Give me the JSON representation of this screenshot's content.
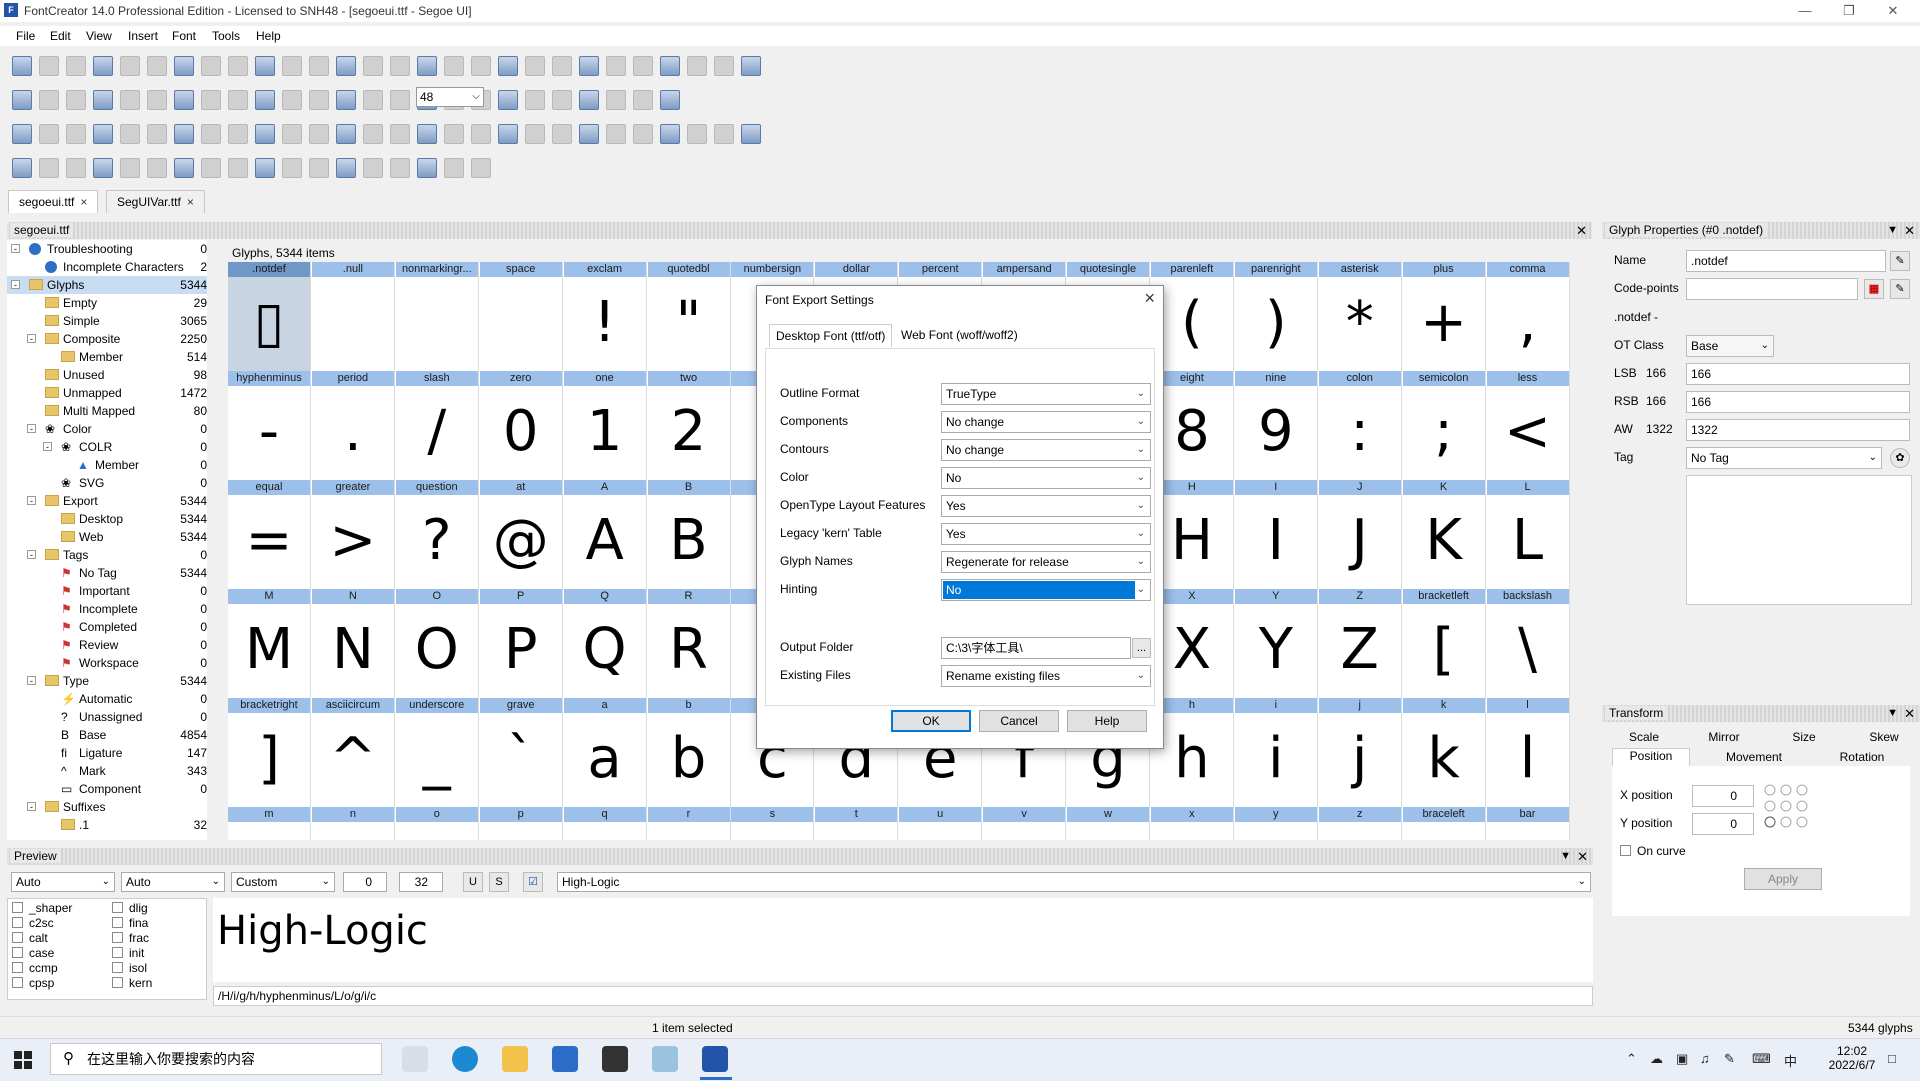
{
  "window": {
    "title": "FontCreator 14.0 Professional Edition - Licensed to SNH48 - [segoeui.ttf - Segoe UI]"
  },
  "menu": [
    "File",
    "Edit",
    "View",
    "Insert",
    "Font",
    "Tools",
    "Help"
  ],
  "toolbar": {
    "zoom_value": "48"
  },
  "file_tabs": [
    {
      "label": "segoeui.ttf",
      "close": "×"
    },
    {
      "label": "SegUIVar.ttf",
      "close": "×"
    }
  ],
  "overview": {
    "panel_title": "segoeui.ttf",
    "grid_caption": "Glyphs, 5344 items",
    "tree": [
      {
        "label": "Troubleshooting",
        "count": "0",
        "icon": "info-icon"
      },
      {
        "label": "Incomplete Characters",
        "count": "2",
        "icon": "info-icon"
      },
      {
        "label": "Glyphs",
        "count": "5344",
        "icon": "folder-icon"
      },
      {
        "label": "Empty",
        "count": "29",
        "icon": "folder-icon"
      },
      {
        "label": "Simple",
        "count": "3065",
        "icon": "folder-icon"
      },
      {
        "label": "Composite",
        "count": "2250",
        "icon": "folder-icon"
      },
      {
        "label": "Member",
        "count": "514",
        "icon": "folder-icon"
      },
      {
        "label": "Unused",
        "count": "98",
        "icon": "folder-icon"
      },
      {
        "label": "Unmapped",
        "count": "1472",
        "icon": "folder-icon"
      },
      {
        "label": "Multi Mapped",
        "count": "80",
        "icon": "folder-icon"
      },
      {
        "label": "Color",
        "count": "0",
        "icon": "palette-icon"
      },
      {
        "label": "COLR",
        "count": "0",
        "icon": "palette-icon"
      },
      {
        "label": "Member",
        "count": "0",
        "icon": "triangle-icon"
      },
      {
        "label": "SVG",
        "count": "0",
        "icon": "palette-icon"
      },
      {
        "label": "Export",
        "count": "5344",
        "icon": "folder-icon"
      },
      {
        "label": "Desktop",
        "count": "5344",
        "icon": "folder-icon"
      },
      {
        "label": "Web",
        "count": "5344",
        "icon": "folder-icon"
      },
      {
        "label": "Tags",
        "count": "0",
        "icon": "folder-icon"
      },
      {
        "label": "No Tag",
        "count": "5344",
        "icon": "flag-icon"
      },
      {
        "label": "Important",
        "count": "0",
        "icon": "flag-icon"
      },
      {
        "label": "Incomplete",
        "count": "0",
        "icon": "flag-icon"
      },
      {
        "label": "Completed",
        "count": "0",
        "icon": "flag-icon"
      },
      {
        "label": "Review",
        "count": "0",
        "icon": "flag-icon"
      },
      {
        "label": "Workspace",
        "count": "0",
        "icon": "flag-icon"
      },
      {
        "label": "Type",
        "count": "5344",
        "icon": "folder-icon"
      },
      {
        "label": "Automatic",
        "count": "0",
        "icon": "bolt-icon"
      },
      {
        "label": "Unassigned",
        "count": "0",
        "icon": "question-icon"
      },
      {
        "label": "Base",
        "count": "4854",
        "icon": "letter-b-icon"
      },
      {
        "label": "Ligature",
        "count": "147",
        "icon": "ligature-icon"
      },
      {
        "label": "Mark",
        "count": "343",
        "icon": "caret-icon"
      },
      {
        "label": "Component",
        "count": "0",
        "icon": "component-icon"
      },
      {
        "label": "Suffixes",
        "count": "",
        "icon": "folder-icon"
      },
      {
        "label": ".1",
        "count": "32",
        "icon": "folder-icon"
      }
    ],
    "glyph_rows": [
      [
        [
          ".notdef",
          "▯"
        ],
        [
          ".null",
          ""
        ],
        [
          "nonmarkingr...",
          ""
        ],
        [
          "space",
          ""
        ],
        [
          "exclam",
          "!"
        ],
        [
          "quotedbl",
          "\""
        ],
        [
          "numbersign",
          ""
        ],
        [
          "dollar",
          ""
        ],
        [
          "percent",
          ""
        ],
        [
          "ampersand",
          ""
        ],
        [
          "quotesingle",
          ""
        ],
        [
          "parenleft",
          "("
        ],
        [
          "parenright",
          ")"
        ],
        [
          "asterisk",
          "*"
        ],
        [
          "plus",
          "+"
        ],
        [
          "comma",
          ","
        ]
      ],
      [
        [
          "hyphenminus",
          "-"
        ],
        [
          "period",
          "."
        ],
        [
          "slash",
          "/"
        ],
        [
          "zero",
          "0"
        ],
        [
          "one",
          "1"
        ],
        [
          "two",
          "2"
        ],
        [
          "",
          ""
        ],
        [
          "",
          ""
        ],
        [
          "",
          ""
        ],
        [
          "",
          ""
        ],
        [
          "",
          ""
        ],
        [
          "eight",
          "8"
        ],
        [
          "nine",
          "9"
        ],
        [
          "colon",
          ":"
        ],
        [
          "semicolon",
          ";"
        ],
        [
          "less",
          "<"
        ]
      ],
      [
        [
          "equal",
          "="
        ],
        [
          "greater",
          ">"
        ],
        [
          "question",
          "?"
        ],
        [
          "at",
          "@"
        ],
        [
          "A",
          "A"
        ],
        [
          "B",
          "B"
        ],
        [
          "",
          ""
        ],
        [
          "",
          ""
        ],
        [
          "",
          ""
        ],
        [
          "",
          ""
        ],
        [
          "",
          ""
        ],
        [
          "H",
          "H"
        ],
        [
          "I",
          "I"
        ],
        [
          "J",
          "J"
        ],
        [
          "K",
          "K"
        ],
        [
          "L",
          "L"
        ]
      ],
      [
        [
          "M",
          "M"
        ],
        [
          "N",
          "N"
        ],
        [
          "O",
          "O"
        ],
        [
          "P",
          "P"
        ],
        [
          "Q",
          "Q"
        ],
        [
          "R",
          "R"
        ],
        [
          "",
          ""
        ],
        [
          "",
          ""
        ],
        [
          "",
          ""
        ],
        [
          "",
          ""
        ],
        [
          "",
          ""
        ],
        [
          "X",
          "X"
        ],
        [
          "Y",
          "Y"
        ],
        [
          "Z",
          "Z"
        ],
        [
          "bracketleft",
          "["
        ],
        [
          "backslash",
          "\\"
        ]
      ],
      [
        [
          "bracketright",
          "]"
        ],
        [
          "asciicircum",
          "^"
        ],
        [
          "underscore",
          "_"
        ],
        [
          "grave",
          "`"
        ],
        [
          "a",
          "a"
        ],
        [
          "b",
          "b"
        ],
        [
          "",
          "c"
        ],
        [
          "",
          "d"
        ],
        [
          "",
          "e"
        ],
        [
          "",
          "f"
        ],
        [
          "",
          "g"
        ],
        [
          "h",
          "h"
        ],
        [
          "i",
          "i"
        ],
        [
          "j",
          "j"
        ],
        [
          "k",
          "k"
        ],
        [
          "l",
          "l"
        ]
      ],
      [
        [
          "m",
          ""
        ],
        [
          "n",
          ""
        ],
        [
          "o",
          ""
        ],
        [
          "p",
          ""
        ],
        [
          "q",
          ""
        ],
        [
          "r",
          ""
        ],
        [
          "s",
          ""
        ],
        [
          "t",
          ""
        ],
        [
          "u",
          ""
        ],
        [
          "v",
          ""
        ],
        [
          "w",
          ""
        ],
        [
          "x",
          ""
        ],
        [
          "y",
          ""
        ],
        [
          "z",
          ""
        ],
        [
          "braceleft",
          ""
        ],
        [
          "bar",
          ""
        ]
      ]
    ]
  },
  "dialog": {
    "title": "Font Export Settings",
    "close": "×",
    "tabs": [
      "Desktop Font (ttf/otf)",
      "Web Font (woff/woff2)"
    ],
    "fields": [
      {
        "label": "Outline Format",
        "value": "TrueType"
      },
      {
        "label": "Components",
        "value": "No change"
      },
      {
        "label": "Contours",
        "value": "No change"
      },
      {
        "label": "Color",
        "value": "No"
      },
      {
        "label": "OpenType Layout Features",
        "value": "Yes"
      },
      {
        "label": "Legacy 'kern' Table",
        "value": "Yes"
      },
      {
        "label": "Glyph Names",
        "value": "Regenerate for release"
      },
      {
        "label": "Hinting",
        "value": "No"
      }
    ],
    "output_folder_label": "Output Folder",
    "output_folder_value": "C:\\3\\字体工具\\",
    "browse": "...",
    "existing_files_label": "Existing Files",
    "existing_files_value": "Rename existing files",
    "ok": "OK",
    "cancel": "Cancel",
    "help": "Help"
  },
  "glyph_properties": {
    "title": "Glyph Properties (#0 .notdef)",
    "name_label": "Name",
    "name_value": ".notdef",
    "codepoints_label": "Code-points",
    "codepoints_value": "",
    "notdef_line": ".notdef -",
    "otclass_label": "OT Class",
    "otclass_value": "Base",
    "lsb_label": "LSB",
    "lsb_small": "166",
    "lsb_value": "166",
    "rsb_label": "RSB",
    "rsb_small": "166",
    "rsb_value": "166",
    "aw_label": "AW",
    "aw_small": "1322",
    "aw_value": "1322",
    "tag_label": "Tag",
    "tag_value": "No Tag"
  },
  "transform": {
    "title": "Transform",
    "tabs_row1": [
      "Scale",
      "Mirror",
      "Size",
      "Skew"
    ],
    "tabs_row2": [
      "Position",
      "Movement",
      "Rotation"
    ],
    "x_label": "X position",
    "x_value": "0",
    "y_label": "Y position",
    "y_value": "0",
    "on_curve": "On curve",
    "apply": "Apply"
  },
  "preview": {
    "title": "Preview",
    "sel1": "Auto",
    "sel2": "Auto",
    "sel3": "Custom",
    "num1": "0",
    "num2": "32",
    "text_value": "High-Logic",
    "sample": "High-Logic",
    "features_col1": [
      "_shaper",
      "c2sc",
      "calt",
      "case",
      "ccmp",
      "cpsp"
    ],
    "features_col2": [
      "dlig",
      "fina",
      "frac",
      "init",
      "isol",
      "kern"
    ],
    "glyph_string": "/H/i/g/h/hyphenminus/L/o/g/i/c"
  },
  "status": {
    "selected": "1 item selected",
    "glyph_count": "5344 glyphs"
  },
  "taskbar": {
    "search_placeholder": "在这里输入你要搜索的内容",
    "time": "12:02",
    "date": "2022/6/7",
    "ime": "中"
  },
  "colors": {
    "accent": "#0078d7",
    "glyph_header": "#9cc0ea",
    "selected_cell": "#c8d4e2"
  }
}
